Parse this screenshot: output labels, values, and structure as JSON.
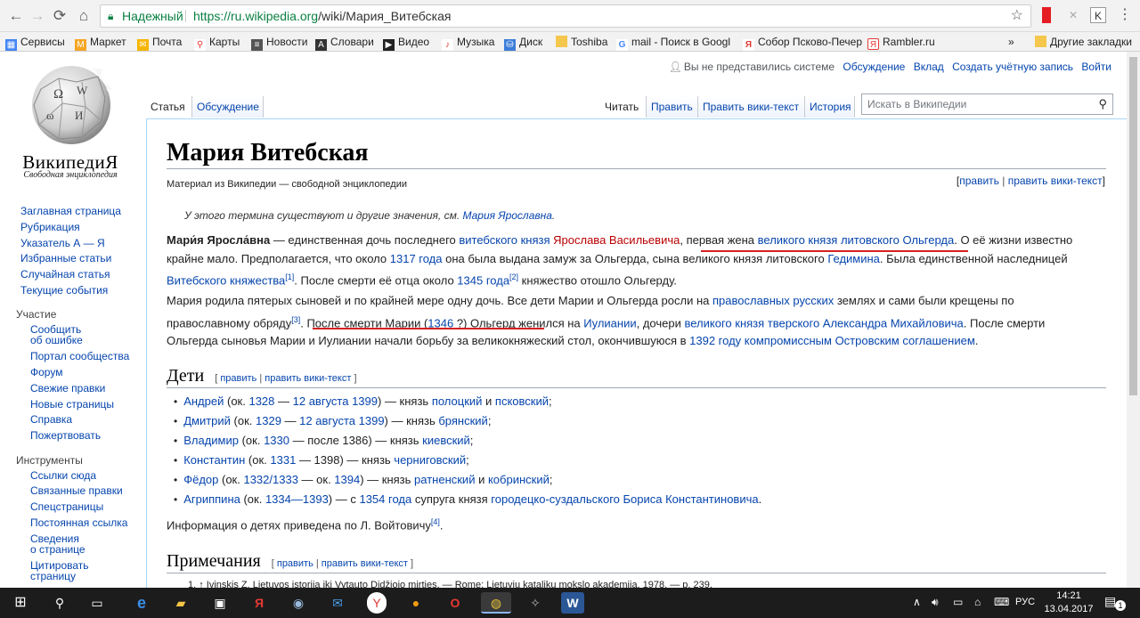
{
  "browser": {
    "secure_label": "Надежный",
    "url_host": "https://ru.wikipedia.org",
    "url_path": "/wiki/Мария_Витебская",
    "bookmarks": [
      {
        "label": "Сервисы",
        "icon": "apps-icon"
      },
      {
        "label": "Маркет",
        "icon": "market-icon"
      },
      {
        "label": "Почта",
        "icon": "mail-icon"
      },
      {
        "label": "Карты",
        "icon": "maps-icon"
      },
      {
        "label": "Новости",
        "icon": "news-icon"
      },
      {
        "label": "Словари",
        "icon": "dictionary-icon"
      },
      {
        "label": "Видео",
        "icon": "video-icon"
      },
      {
        "label": "Музыка",
        "icon": "music-icon"
      },
      {
        "label": "Диск",
        "icon": "disk-icon"
      },
      {
        "label": "Toshiba",
        "icon": "folder-icon"
      },
      {
        "label": "mail - Поиск в Googl",
        "icon": "google-icon"
      },
      {
        "label": "Собор Псково-Печер",
        "icon": "yandex-icon"
      },
      {
        "label": "Rambler.ru",
        "icon": "rambler-icon"
      }
    ],
    "more": "»",
    "other_bookmarks": "Другие закладки"
  },
  "wiki": {
    "logo_title": "ВикипедиЯ",
    "logo_sub": "Свободная энциклопедия",
    "personal": {
      "not_logged": "Вы не представились системе",
      "talk": "Обсуждение",
      "contrib": "Вклад",
      "create": "Создать учётную запись",
      "login": "Войти"
    },
    "tabs": {
      "article": "Статья",
      "talk": "Обсуждение",
      "read": "Читать",
      "edit": "Править",
      "edit_source": "Править вики-текст",
      "history": "История"
    },
    "search_placeholder": "Искать в Википедии",
    "sidebar": {
      "main": [
        "Заглавная страница",
        "Рубрикация",
        "Указатель А — Я",
        "Избранные статьи",
        "Случайная статья",
        "Текущие события"
      ],
      "participation_head": "Участие",
      "participation": [
        "Сообщить",
        "об ошибке",
        "Портал сообщества",
        "Форум",
        "Свежие правки",
        "Новые страницы",
        "Справка",
        "Пожертвовать"
      ],
      "tools_head": "Инструменты",
      "tools": [
        "Ссылки сюда",
        "Связанные правки",
        "Спецстраницы",
        "Постоянная ссылка",
        "Сведения",
        "о странице",
        "Цитировать",
        "страницу"
      ]
    },
    "title": "Мария Витебская",
    "from": "Материал из Википедии — свободной энциклопедии",
    "edit_bracket_open": "[",
    "edit": "править",
    "pipe": " | ",
    "edit_source": "править вики-текст",
    "edit_bracket_close": "]",
    "hatnote_text": "У этого термина существуют и другие значения, см. ",
    "hatnote_link": "Мария Ярославна",
    "hatnote_end": ".",
    "p1": {
      "bold": "Мари́я Яросла́вна",
      "t1": " — единственная дочь последнего ",
      "l1": "витебского князя",
      "t2": " ",
      "l2": "Ярослава Васильевича",
      "t3": ", ",
      "t4": "первая жена ",
      "l3": "великого князя литовского Ольгерда",
      "t5": ". О её жизни известно",
      "t6": "крайне мало. Предполагается, что около ",
      "l4": "1317 года",
      "t7": " она была выдана замуж за Ольгерда, сына великого князя литовского ",
      "l5": "Гедимина",
      "t8": ". Была единственной наследницей",
      "l6": "Витебского княжества",
      "r1": "[1]",
      "t9": ". После смерти её отца около ",
      "l7": "1345 года",
      "r2": "[2]",
      "t10": " княжество отошло Ольгерду."
    },
    "p2": {
      "t1": "Мария родила пятерых сыновей и по крайней мере одну дочь. Все дети Марии и Ольгерда росли на ",
      "l1": "православных",
      "t2": " ",
      "l2": "русских",
      "t3": " землях и сами были крещены по",
      "t4": "православному обряду",
      "r3": "[3]",
      "t5": ". ",
      "t6": "После смерти Марии (",
      "l3": "1346",
      "t7": " ?) Ольгерд женился на ",
      "l4": "Иулиании",
      "t8": ", дочери ",
      "l5": "великого князя тверского Александра Михайловича",
      "t9": ". После смерти",
      "t10": "Ольгерда сыновья Марии и Иулиании начали борьбу за великокняжеский стол, окончившуюся в ",
      "l6": "1392 году",
      "t11": " ",
      "l7": "компромиссным Островским соглашением",
      "t12": "."
    },
    "children_head": "Дети",
    "children": [
      {
        "name": "Андрей",
        "p1": " (ок. ",
        "y1": "1328",
        "d": " — ",
        "y2": "12 августа 1399",
        "p2": ") — князь ",
        "l1": "полоцкий",
        "and": " и ",
        "l2": "псковский",
        "end": ";"
      },
      {
        "name": "Дмитрий",
        "p1": " (ок. ",
        "y1": "1329",
        "d": " — ",
        "y2": "12 августа 1399",
        "p2": ") — князь ",
        "l1": "брянский",
        "and": "",
        "l2": "",
        "end": ";"
      },
      {
        "name": "Владимир",
        "p1": " (ок. ",
        "y1": "1330",
        "d": " — после 1386",
        "y2": "",
        "p2": ") — князь ",
        "l1": "киевский",
        "and": "",
        "l2": "",
        "end": ";"
      },
      {
        "name": "Константин",
        "p1": " (ок. ",
        "y1": "1331",
        "d": " — 1398",
        "y2": "",
        "p2": ") — князь ",
        "l1": "черниговский",
        "and": "",
        "l2": "",
        "end": ";"
      },
      {
        "name": "Фёдор",
        "p1": " (ок. ",
        "y1": "1332/1333",
        "d": " — ок. ",
        "y2": "1394",
        "p2": ") — князь ",
        "l1": "ратненский",
        "and": " и ",
        "l2": "кобринский",
        "end": ";"
      },
      {
        "name": "Агриппина",
        "p1": " (ок. ",
        "y1": "1334—1393",
        "d": "",
        "y2": "",
        "p2": ") — с ",
        "l1": "1354 года",
        "and": " супруга князя ",
        "l2": "городецко-суздальского Бориса Константиновича",
        "end": "."
      }
    ],
    "info_text": "Информация о детях приведена по Л. Войтовичу",
    "info_ref": "[4]",
    "info_end": ".",
    "notes_head": "Примечания",
    "notes_peek": "1. ↑ Ivinskis Z. Lietuvos istorija iki Vytauto Didžiojo mirties. — Rome: Lietuvių katalikų mokslo akademija, 1978. — p. 239."
  },
  "taskbar": {
    "lang": "РУС",
    "time": "14:21",
    "date": "13.04.2017",
    "notif": "1"
  }
}
